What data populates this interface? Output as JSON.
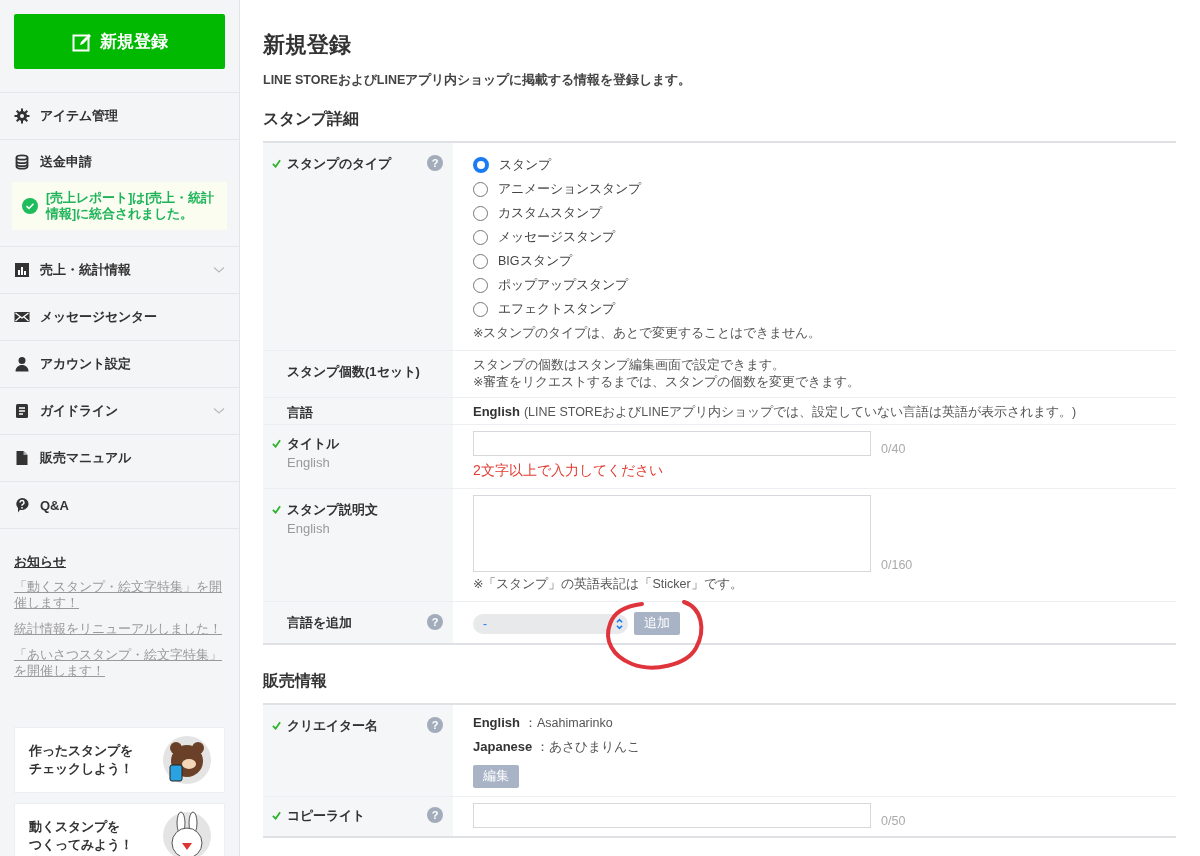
{
  "sidebar": {
    "new_button": "新規登録",
    "nav": [
      {
        "label": "アイテム管理",
        "expandable": false
      },
      {
        "label": "送金申請",
        "expandable": false,
        "notice": "[売上レポート]は[売上・統計情報]に統合されました。"
      },
      {
        "label": "売上・統計情報",
        "expandable": true
      },
      {
        "label": "メッセージセンター",
        "expandable": false
      },
      {
        "label": "アカウント設定",
        "expandable": false
      },
      {
        "label": "ガイドライン",
        "expandable": true
      },
      {
        "label": "販売マニュアル",
        "expandable": false
      },
      {
        "label": "Q&A",
        "expandable": false
      }
    ],
    "news": {
      "title": "お知らせ",
      "links": [
        "「動くスタンプ・絵文字特集」を開催します！",
        "統計情報をリニューアルしました！",
        "「あいさつスタンプ・絵文字特集」を開催します！"
      ]
    },
    "promos": [
      [
        "作ったスタンプを",
        "チェックしよう！"
      ],
      [
        "動くスタンプを",
        "つくってみよう！"
      ]
    ]
  },
  "main": {
    "title": "新規登録",
    "description": "LINE STOREおよびLINEアプリ内ショップに掲載する情報を登録します。",
    "sections": [
      {
        "title": "スタンプ詳細",
        "rows": [
          {
            "kind": "radio",
            "label": "スタンプのタイプ",
            "required": true,
            "help": "?",
            "options": [
              {
                "label": "スタンプ",
                "selected": true
              },
              {
                "label": "アニメーションスタンプ",
                "selected": false
              },
              {
                "label": "カスタムスタンプ",
                "selected": false
              },
              {
                "label": "メッセージスタンプ",
                "selected": false
              },
              {
                "label": "BIGスタンプ",
                "selected": false
              },
              {
                "label": "ポップアップスタンプ",
                "selected": false
              },
              {
                "label": "エフェクトスタンプ",
                "selected": false
              }
            ],
            "note": "※スタンプのタイプは、あとで変更することはできません。"
          },
          {
            "kind": "text",
            "label": "スタンプ個数(1セット)",
            "required": false,
            "lines": [
              "スタンプの個数はスタンプ編集画面で設定できます。",
              "※審査をリクエストするまでは、スタンプの個数を変更できます。"
            ]
          },
          {
            "kind": "language",
            "label": "言語",
            "required": false,
            "language": "English",
            "text": "(LINE STOREおよびLINEアプリ内ショップでは、設定していない言語は英語が表示されます。)"
          },
          {
            "kind": "input",
            "label": "タイトル",
            "sublabel": "English",
            "required": true,
            "counter": "0/40",
            "error": "2文字以上で入力してください"
          },
          {
            "kind": "textarea",
            "label": "スタンプ説明文",
            "sublabel": "English",
            "required": true,
            "counter": "0/160",
            "note": "※「スタンプ」の英語表記は「Sticker」です。"
          },
          {
            "kind": "language_add",
            "label": "言語を追加",
            "required": false,
            "help": "?",
            "select": "-",
            "button": "追加",
            "annotated": true
          }
        ]
      },
      {
        "title": "販売情報",
        "rows": [
          {
            "kind": "creator",
            "label": "クリエイター名",
            "required": true,
            "help": "?",
            "entries": [
              {
                "language": "English",
                "value": "：Asahimarinko"
              },
              {
                "language": "Japanese",
                "value": "：あさひまりんこ"
              }
            ],
            "button": "編集"
          },
          {
            "kind": "input",
            "label": "コピーライト",
            "required": true,
            "help": "?",
            "counter": "0/50"
          }
        ]
      }
    ]
  }
}
